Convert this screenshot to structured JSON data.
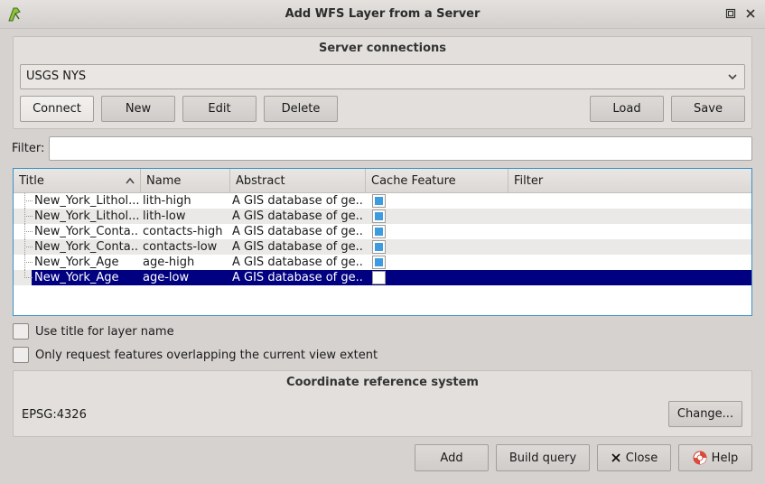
{
  "window": {
    "title": "Add WFS Layer from a Server"
  },
  "server_connections": {
    "title": "Server connections",
    "selected": "USGS NYS",
    "buttons": {
      "connect": "Connect",
      "new": "New",
      "edit": "Edit",
      "delete": "Delete",
      "load": "Load",
      "save": "Save"
    }
  },
  "filter": {
    "label": "Filter:",
    "value": ""
  },
  "table": {
    "columns": [
      "Title",
      "Name",
      "Abstract",
      "Cache Feature",
      "Filter"
    ],
    "rows": [
      {
        "title": "New_York_Lithol...",
        "name": "lith-high",
        "abstract": "A GIS database of ge...",
        "cache": true
      },
      {
        "title": "New_York_Lithol...",
        "name": "lith-low",
        "abstract": "A GIS database of ge...",
        "cache": true
      },
      {
        "title": "New_York_Conta...",
        "name": "contacts-high",
        "abstract": "A GIS database of ge...",
        "cache": true
      },
      {
        "title": "New_York_Conta...",
        "name": "contacts-low",
        "abstract": "A GIS database of ge...",
        "cache": true
      },
      {
        "title": "New_York_Age",
        "name": "age-high",
        "abstract": "A GIS database of ge...",
        "cache": true
      },
      {
        "title": "New_York_Age",
        "name": "age-low",
        "abstract": "A GIS database of ge...",
        "cache": false
      }
    ],
    "selected_row": 5
  },
  "options": {
    "use_title": "Use title for layer name",
    "only_overlapping": "Only request features overlapping the current view extent"
  },
  "crs": {
    "title": "Coordinate reference system",
    "value": "EPSG:4326",
    "change": "Change..."
  },
  "footer": {
    "add": "Add",
    "build_query": "Build query",
    "close": "Close",
    "help": "Help"
  },
  "colors": {
    "selection": "#000080",
    "checkbox_fill": "#3d9be0",
    "focus_border": "#3c8fc8"
  }
}
